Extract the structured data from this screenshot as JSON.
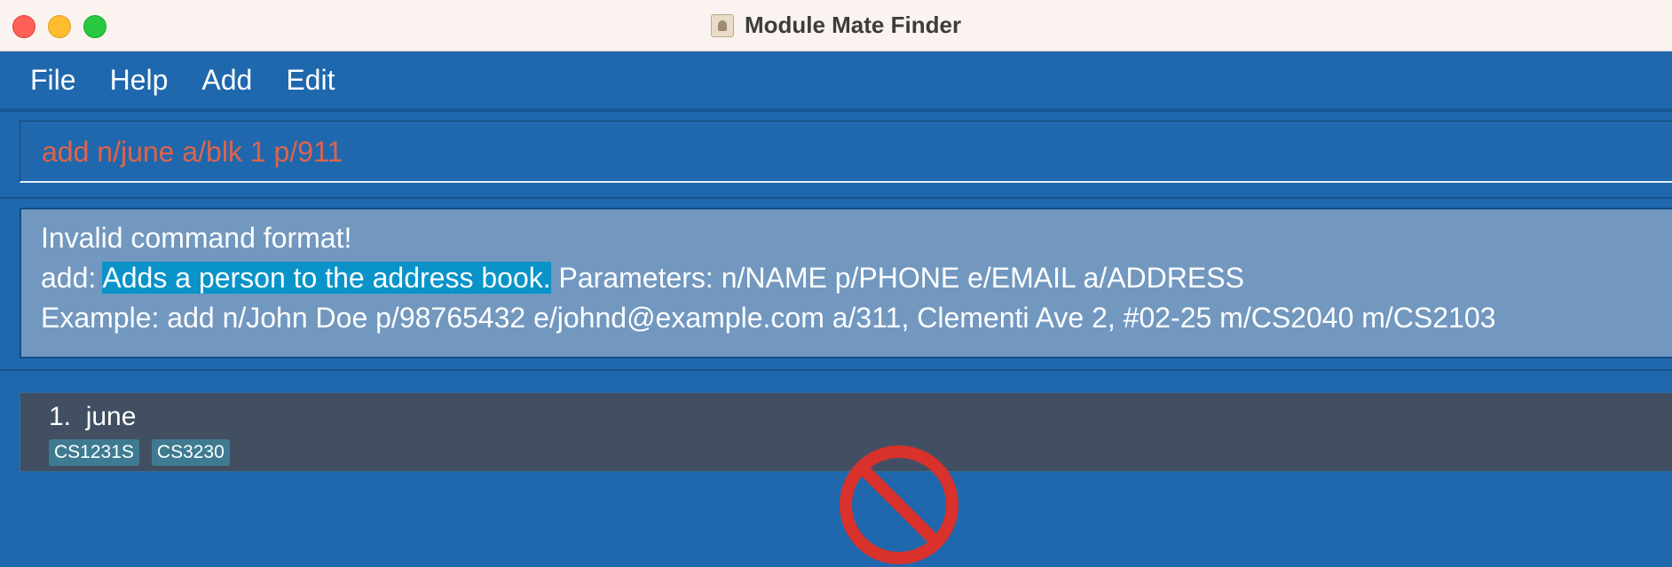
{
  "window": {
    "title": "Module Mate Finder"
  },
  "menu": {
    "items": [
      "File",
      "Help",
      "Add",
      "Edit"
    ]
  },
  "command": {
    "value": "add n/june a/blk 1 p/911"
  },
  "result": {
    "line1": "Invalid command format!",
    "line2_prefix": "add: ",
    "line2_highlight": "Adds a person to the address book.",
    "line2_suffix": " Parameters: n/NAME p/PHONE e/EMAIL a/ADDRESS",
    "line3": "Example: add n/John Doe p/98765432 e/johnd@example.com a/311, Clementi Ave 2, #02-25 m/CS2040 m/CS2103"
  },
  "persons": [
    {
      "index": "1.",
      "name": "june",
      "tags": [
        "CS1231S",
        "CS3230"
      ]
    }
  ],
  "colors": {
    "accent": "#1f68ad",
    "command_error_text": "#e0634b",
    "result_bg": "#7298c0",
    "highlight": "#0a93c9",
    "card_bg": "#424f63",
    "tag_bg": "#3e7b91",
    "prohibited_red": "#d9312b"
  },
  "icons": {
    "cursor": "prohibited-icon"
  }
}
